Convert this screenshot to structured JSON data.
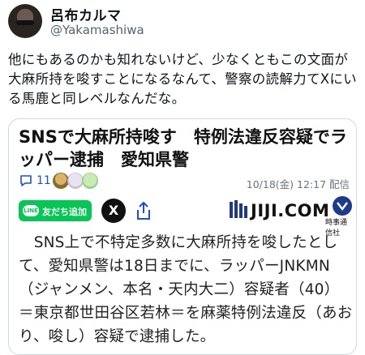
{
  "profile": {
    "display_name": "呂布カルマ",
    "handle": "@Yakamashiwa"
  },
  "tweet": {
    "text": "他にもあるのかも知れないけど、少なくともこの文面が大麻所持を唆すことになるなんて、警察の読解力てXにいる馬鹿と同レベルなんだな。"
  },
  "card": {
    "headline": "SNSで大麻所持唆す　特例法違反容疑でラッパー逮捕　愛知県警",
    "comment_count": "11",
    "timestamp": "10/18(金) 12:17 配信",
    "line_button_label": "友だち追加",
    "line_logo_text": "LINE",
    "x_button_label": "X",
    "publisher_name": "JIJI.COM",
    "publisher_sub": "時事通信社",
    "body": "　SNS上で不特定多数に大麻所持を唆したとして、愛知県警は18日までに、ラッパーJNKMN（ジャンメン、本名・天内大二）容疑者（40）＝東京都世田谷区若林＝を麻薬特例法違反（あおり、唆し）容疑で逮捕した。"
  },
  "icons": [
    "comment-icon",
    "share-icon",
    "x-logo-icon",
    "line-icon"
  ],
  "colors": {
    "line_green": "#06c755",
    "link_blue": "#1d4ed8",
    "border": "#cfd9de"
  }
}
